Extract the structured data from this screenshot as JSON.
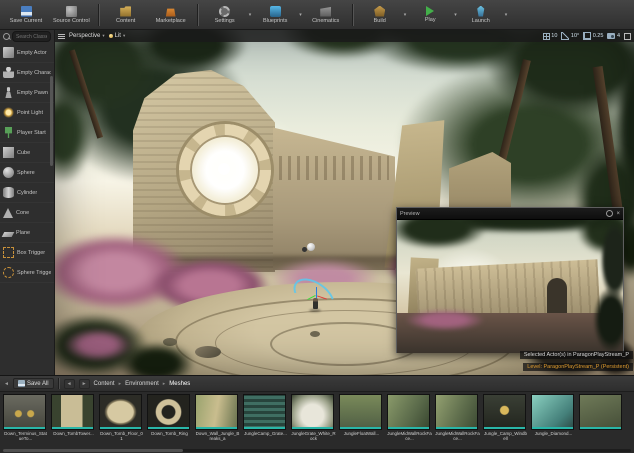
{
  "glyphs": {
    "caret_down": "▾",
    "chevron_right": "▸",
    "back_arrow": "◄",
    "forward_arrow": "►",
    "close": "×"
  },
  "toolbar": {
    "buttons": [
      {
        "label": "Save Current"
      },
      {
        "label": "Source Control"
      },
      {
        "label": "Content"
      },
      {
        "label": "Marketplace"
      },
      {
        "label": "Settings"
      },
      {
        "label": "Blueprints"
      },
      {
        "label": "Cinematics"
      },
      {
        "label": "Build"
      },
      {
        "label": "Play"
      },
      {
        "label": "Launch"
      }
    ]
  },
  "place_actors": {
    "search_placeholder": "Search Classes",
    "items": [
      {
        "label": "Empty Actor"
      },
      {
        "label": "Empty Character"
      },
      {
        "label": "Empty Pawn"
      },
      {
        "label": "Point Light"
      },
      {
        "label": "Player Start"
      },
      {
        "label": "Cube"
      },
      {
        "label": "Sphere"
      },
      {
        "label": "Cylinder"
      },
      {
        "label": "Cone"
      },
      {
        "label": "Plane"
      },
      {
        "label": "Box Trigger"
      },
      {
        "label": "Sphere Trigger"
      }
    ]
  },
  "viewport": {
    "perspective_label": "Perspective",
    "lit_label": "Lit",
    "snap_move": "10",
    "snap_rotate": "10°",
    "snap_scale": "0.25",
    "camera_speed": "4",
    "status_selected": "Selected Actor(s) in  ParagonPlayStream_P",
    "status_level": "Level: ParagonPlayStream_P (Persistent)"
  },
  "preview_window": {
    "title": "Preview"
  },
  "content_browser": {
    "save_all_label": "Save All",
    "breadcrumb": [
      {
        "label": "Content"
      },
      {
        "label": "Environment"
      },
      {
        "label": "Meshes"
      }
    ],
    "assets": [
      {
        "name": "Down_Terminus_StatueTo..."
      },
      {
        "name": "Down_TombTower..."
      },
      {
        "name": "Down_Tomb_Floor_01"
      },
      {
        "name": "Down_Tomb_Ring"
      },
      {
        "name": "Down_Wall_Jungle_Breaks_a"
      },
      {
        "name": "JungleCamp_Grate..."
      },
      {
        "name": "JungleGrate_White_Rock"
      },
      {
        "name": "JungleFloatWall..."
      },
      {
        "name": "JungleMidWallRockFace..."
      },
      {
        "name": "JungleMidWallRockFace..."
      },
      {
        "name": "Jungle_Camp_Windbell"
      },
      {
        "name": "Jungle_Diamond..."
      },
      {
        "name": ""
      }
    ]
  },
  "colors": {
    "level_status_orange": "#e09c2f",
    "asset_type_stripe_teal": "#29b6a8",
    "play_green": "#43b04a"
  }
}
